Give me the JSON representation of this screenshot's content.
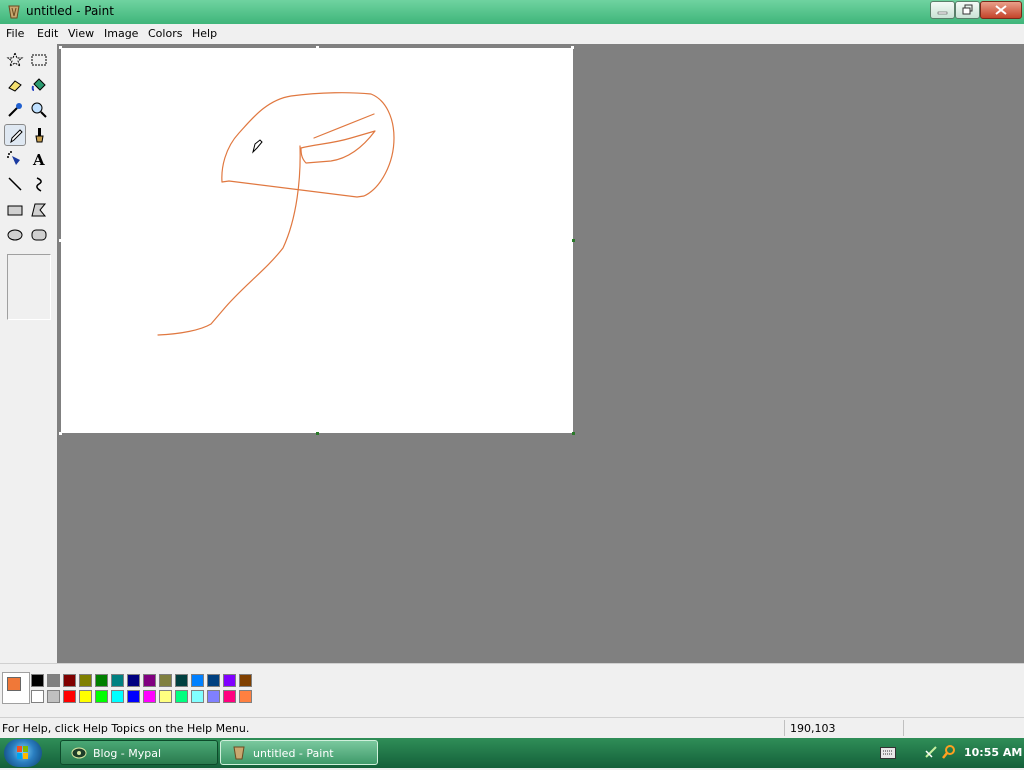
{
  "window": {
    "title": "untitled - Paint"
  },
  "menu": {
    "items": [
      "File",
      "Edit",
      "View",
      "Image",
      "Colors",
      "Help"
    ]
  },
  "toolbox": {
    "tools": [
      {
        "name": "free-form-select",
        "icon": "star-select-icon"
      },
      {
        "name": "rectangle-select",
        "icon": "rect-select-icon"
      },
      {
        "name": "eraser",
        "icon": "eraser-icon"
      },
      {
        "name": "fill-with-color",
        "icon": "bucket-icon"
      },
      {
        "name": "pick-color",
        "icon": "eyedropper-icon"
      },
      {
        "name": "magnifier",
        "icon": "magnifier-icon"
      },
      {
        "name": "pencil",
        "icon": "pencil-icon",
        "selected": true
      },
      {
        "name": "brush",
        "icon": "brush-icon"
      },
      {
        "name": "airbrush",
        "icon": "airbrush-icon"
      },
      {
        "name": "text",
        "icon": "text-icon"
      },
      {
        "name": "line",
        "icon": "line-icon"
      },
      {
        "name": "curve",
        "icon": "curve-icon"
      },
      {
        "name": "rectangle",
        "icon": "rectangle-icon"
      },
      {
        "name": "polygon",
        "icon": "polygon-icon"
      },
      {
        "name": "ellipse",
        "icon": "ellipse-icon"
      },
      {
        "name": "rounded-rectangle",
        "icon": "rounded-rect-icon"
      }
    ]
  },
  "palette": {
    "foreground": "#f07838",
    "background": "#ffffff",
    "top_row": [
      "#000000",
      "#808080",
      "#800000",
      "#808000",
      "#008000",
      "#008080",
      "#000080",
      "#800080",
      "#808040",
      "#004040",
      "#0080ff",
      "#004080",
      "#8000ff",
      "#804000"
    ],
    "bottom_row": [
      "#ffffff",
      "#c0c0c0",
      "#ff0000",
      "#ffff00",
      "#00ff00",
      "#00ffff",
      "#0000ff",
      "#ff00ff",
      "#ffff80",
      "#00ff80",
      "#80ffff",
      "#8080ff",
      "#ff0080",
      "#ff8040"
    ]
  },
  "drawing": {
    "stroke_color": "#e07840"
  },
  "status": {
    "help_text": "For Help, click Help Topics on the Help Menu.",
    "coords": "190,103"
  },
  "taskbar": {
    "tasks": [
      {
        "label": "Blog - Mypal",
        "icon": "mypal-icon",
        "active": false
      },
      {
        "label": "untitled - Paint",
        "icon": "paint-icon",
        "active": true
      }
    ],
    "clock": "10:55 AM"
  }
}
